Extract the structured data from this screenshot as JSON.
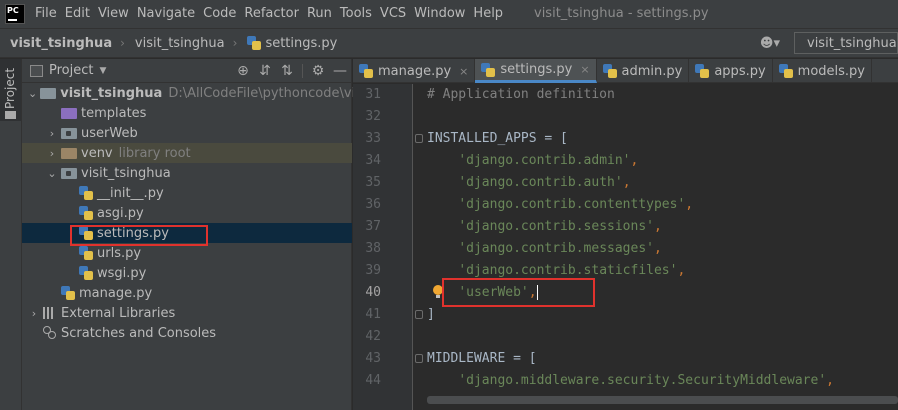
{
  "menubar": {
    "logo": "PC",
    "items": [
      "File",
      "Edit",
      "View",
      "Navigate",
      "Code",
      "Refactor",
      "Run",
      "Tools",
      "VCS",
      "Window",
      "Help"
    ],
    "window_title": "visit_tsinghua - settings.py"
  },
  "navbar": {
    "crumbs": [
      "visit_tsinghua",
      "visit_tsinghua",
      "settings.py"
    ],
    "user_icon": "user-icon",
    "run_config": "visit_tsinghua"
  },
  "left_strip": {
    "label": "Project"
  },
  "project": {
    "title": "Project",
    "tools": [
      "crosshair-icon",
      "collapse-icon",
      "expand-icon",
      "gear-icon",
      "hide-icon"
    ],
    "tree": [
      {
        "label": "visit_tsinghua",
        "extra": "D:\\AllCodeFile\\pythoncode\\visit_ts",
        "kind": "folder-grey",
        "indent": 0,
        "arrow": "down",
        "bold": true
      },
      {
        "label": "templates",
        "extra": "",
        "kind": "folder-purple",
        "indent": 1,
        "arrow": ""
      },
      {
        "label": "userWeb",
        "extra": "",
        "kind": "folder-grey-dot",
        "indent": 1,
        "arrow": "right"
      },
      {
        "label": "venv",
        "extra": "library root",
        "kind": "folder-brown",
        "indent": 1,
        "arrow": "right"
      },
      {
        "label": "visit_tsinghua",
        "extra": "",
        "kind": "folder-grey-dot",
        "indent": 1,
        "arrow": "down"
      },
      {
        "label": "__init__.py",
        "extra": "",
        "kind": "py",
        "indent": 2,
        "arrow": ""
      },
      {
        "label": "asgi.py",
        "extra": "",
        "kind": "py",
        "indent": 2,
        "arrow": ""
      },
      {
        "label": "settings.py",
        "extra": "",
        "kind": "py",
        "indent": 2,
        "arrow": "",
        "selected": true
      },
      {
        "label": "urls.py",
        "extra": "",
        "kind": "py",
        "indent": 2,
        "arrow": ""
      },
      {
        "label": "wsgi.py",
        "extra": "",
        "kind": "py",
        "indent": 2,
        "arrow": ""
      },
      {
        "label": "manage.py",
        "extra": "",
        "kind": "py",
        "indent": 1,
        "arrow": ""
      },
      {
        "label": "External Libraries",
        "extra": "",
        "kind": "lib",
        "indent": 0,
        "arrow": "right"
      },
      {
        "label": "Scratches and Consoles",
        "extra": "",
        "kind": "scratch",
        "indent": 0,
        "arrow": ""
      }
    ]
  },
  "tabs": [
    {
      "label": "manage.py",
      "active": false
    },
    {
      "label": "settings.py",
      "active": true
    },
    {
      "label": "admin.py",
      "active": false
    },
    {
      "label": "apps.py",
      "active": false
    },
    {
      "label": "models.py",
      "active": false
    }
  ],
  "editor": {
    "lines": [
      {
        "n": "31",
        "code": "# Application definition",
        "style": "comment"
      },
      {
        "n": "32",
        "code": "",
        "style": "plain"
      },
      {
        "n": "33",
        "code": "INSTALLED_APPS = [",
        "style": "plain",
        "fold": true
      },
      {
        "n": "34",
        "code": "    'django.contrib.admin',",
        "style": "str"
      },
      {
        "n": "35",
        "code": "    'django.contrib.auth',",
        "style": "str"
      },
      {
        "n": "36",
        "code": "    'django.contrib.contenttypes',",
        "style": "str"
      },
      {
        "n": "37",
        "code": "    'django.contrib.sessions',",
        "style": "str"
      },
      {
        "n": "38",
        "code": "    'django.contrib.messages',",
        "style": "str"
      },
      {
        "n": "39",
        "code": "    'django.contrib.staticfiles',",
        "style": "str"
      },
      {
        "n": "40",
        "code": "    'userWeb',",
        "style": "str",
        "current": true
      },
      {
        "n": "41",
        "code": "]",
        "style": "plain",
        "fold": true
      },
      {
        "n": "42",
        "code": "",
        "style": "plain"
      },
      {
        "n": "43",
        "code": "MIDDLEWARE = [",
        "style": "plain",
        "fold": true
      },
      {
        "n": "44",
        "code": "    'django.middleware.security.SecurityMiddleware',",
        "style": "str"
      }
    ]
  },
  "colors": {
    "accent": "#4a88c7",
    "highlight": "#e0322d",
    "string": "#6a8759",
    "keyword": "#cc7832",
    "comment": "#808080"
  }
}
